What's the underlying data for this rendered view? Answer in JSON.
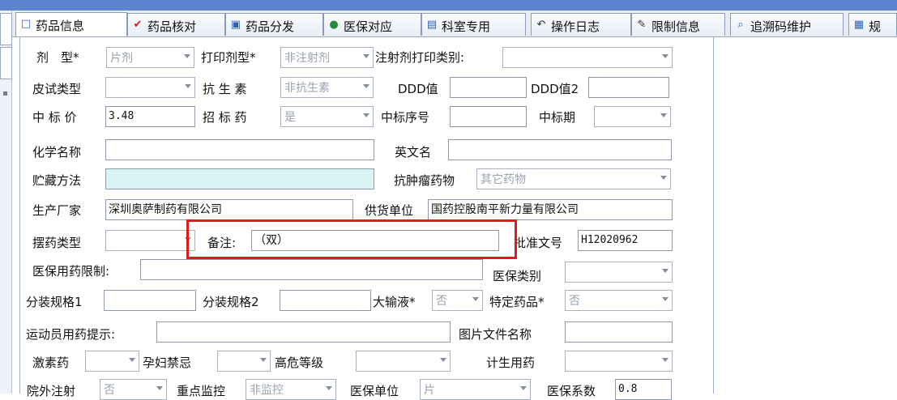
{
  "tabs": [
    {
      "label": "药品信息",
      "icon": "□",
      "icon_color": "#2f60c0",
      "active": true
    },
    {
      "label": "药品核对",
      "icon": "✔",
      "icon_color": "#d41a1a"
    },
    {
      "label": "药品分发",
      "icon": "▣",
      "icon_color": "#2b5fb0"
    },
    {
      "label": "医保对应",
      "icon": "●",
      "icon_color": "#2a8a3a"
    },
    {
      "label": "科室专用",
      "icon": "▤",
      "icon_color": "#2f60c0"
    },
    {
      "label": "操作日志",
      "icon": "↶",
      "icon_color": "#333333"
    },
    {
      "label": "限制信息",
      "icon": "✎",
      "icon_color": "#333333"
    },
    {
      "label": "追溯码维护",
      "icon": "⌕",
      "icon_color": "#2f60c0"
    },
    {
      "label": "规",
      "icon": "▦",
      "icon_color": "#2f60c0"
    }
  ],
  "form": {
    "dosage": {
      "label": "剂　型*",
      "value": "片剂"
    },
    "print_type": {
      "label": "打印剂型*",
      "value": "非注射剂"
    },
    "injection_print": {
      "label": "注射剂打印类别:",
      "value": ""
    },
    "skin_test": {
      "label": "皮试类型",
      "value": ""
    },
    "antibiotic": {
      "label": "抗 生 素",
      "value": "非抗生素"
    },
    "ddd": {
      "label": "DDD值",
      "value": ""
    },
    "ddd2": {
      "label": "DDD值2",
      "value": ""
    },
    "bid_price": {
      "label": "中 标 价",
      "value": "3.48"
    },
    "bid_drug": {
      "label": "招 标 药",
      "value": "是"
    },
    "bid_no": {
      "label": "中标序号",
      "value": ""
    },
    "bid_period": {
      "label": "中标期",
      "value": ""
    },
    "chem_name": {
      "label": "化学名称",
      "value": ""
    },
    "eng_name": {
      "label": "英文名",
      "value": ""
    },
    "storage": {
      "label": "贮藏方法",
      "value": ""
    },
    "antitumor": {
      "label": "抗肿瘤药物",
      "value": "其它药物"
    },
    "manufacturer": {
      "label": "生产厂家",
      "value": "深圳奥萨制药有限公司"
    },
    "supplier": {
      "label": "供货单位",
      "value": "国药控股南平新力量有限公司"
    },
    "arrange_type": {
      "label": "摆药类型",
      "value": ""
    },
    "remark": {
      "label": "备注:",
      "value": "（双）"
    },
    "approval": {
      "label": "批准文号",
      "value": "H12020962"
    },
    "insurance_limit": {
      "label": "医保用药限制:",
      "value": ""
    },
    "insurance_class": {
      "label": "医保类别",
      "value": ""
    },
    "spec1": {
      "label": "分装规格1",
      "value": ""
    },
    "spec2": {
      "label": "分装规格2",
      "value": ""
    },
    "large_infusion": {
      "label": "大输液*",
      "value": "否"
    },
    "special_drug": {
      "label": "特定药品*",
      "value": "否"
    },
    "athlete_tip": {
      "label": "运动员用药提示:",
      "value": ""
    },
    "image_file": {
      "label": "图片文件名称",
      "value": ""
    },
    "hormone": {
      "label": "激素药",
      "value": ""
    },
    "pregnancy": {
      "label": "孕妇禁忌",
      "value": ""
    },
    "high_risk": {
      "label": "高危等级",
      "value": ""
    },
    "family_planning": {
      "label": "计生用药",
      "value": ""
    },
    "outpatient_inj": {
      "label": "院外注射",
      "value": "否"
    },
    "key_monitor": {
      "label": "重点监控",
      "value": "非监控"
    },
    "insurance_unit": {
      "label": "医保单位",
      "value": "片"
    },
    "insurance_coef": {
      "label": "医保系数",
      "value": "0.8"
    }
  },
  "colors": {
    "highlight": "#e11b1b",
    "teal_field": "#d8f3f1",
    "title_bar": "#5d83cf"
  }
}
